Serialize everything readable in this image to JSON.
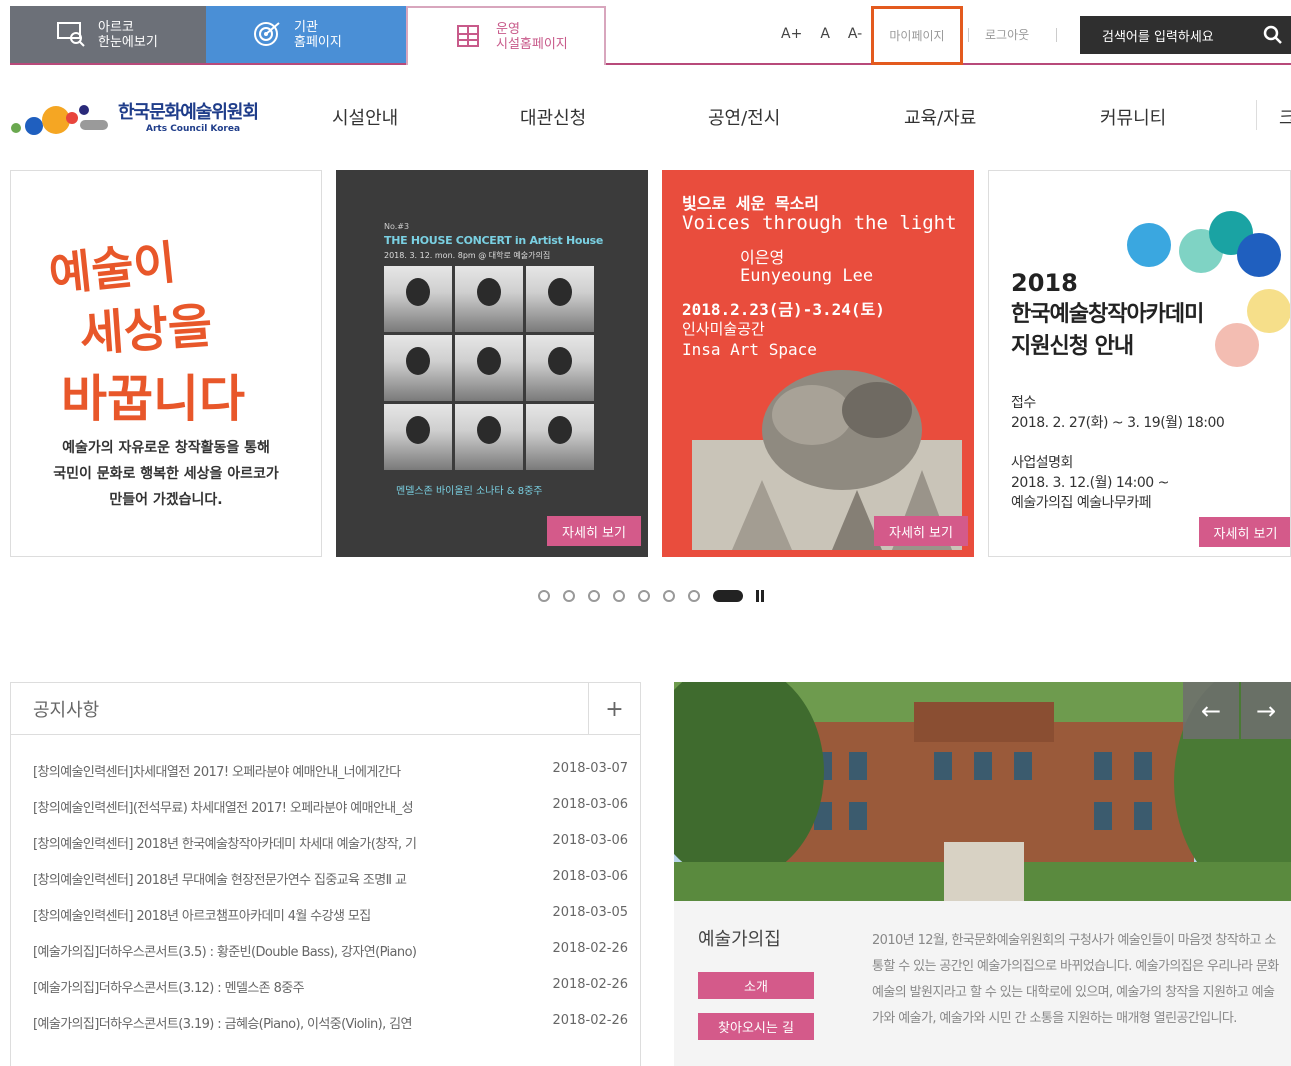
{
  "topbar": {
    "tabs": [
      {
        "label": "아르코\n한눈에보기",
        "icon": "monitor-search-icon"
      },
      {
        "label": "기관\n홈페이지",
        "icon": "target-icon"
      },
      {
        "label": "운영\n시설홈페이지",
        "icon": "building-icon"
      }
    ],
    "font_sizes": [
      "A+",
      "A",
      "A-"
    ],
    "mypage": "마이페이지",
    "logout": "로그아웃",
    "search_placeholder": "검색어를 입력하세요",
    "highlight_color": "#e35a1e"
  },
  "logo": {
    "kr": "한국문화예술위원회",
    "en": "Arts Council Korea"
  },
  "nav": {
    "items": [
      "시설안내",
      "대관신청",
      "공연/전시",
      "교육/자료",
      "커뮤니티"
    ],
    "more": "크"
  },
  "banners": {
    "b1": {
      "calligraphy": "예술이 세상을 바꿉니다",
      "desc": "예술가의 자유로운 창작활동을 통해\n국민이 문화로 행복한 세상을 아르코가\n만들어 가겠습니다."
    },
    "b2": {
      "no": "No.#3",
      "title": "THE HOUSE CONCERT in Artist House",
      "date": "2018. 3. 12. mon. 8pm @ 대학로 예술가의집",
      "caption": "멘델스존 바이올린 소나타 & 8중주",
      "more": "자세히 보기"
    },
    "b3": {
      "line1": "빛으로 세운 목소리",
      "line2": "Voices through the light",
      "line3": "이은영",
      "line4": "Eunyeoung Lee",
      "line5": "2018.2.23(금)-3.24(토)",
      "line6": "인사미술공간",
      "line7": "Insa Art Space",
      "more": "자세히 보기"
    },
    "b4": {
      "year": "2018",
      "head": "한국예술창작아카데미\n지원신청 안내",
      "info1": "접수\n2018. 2. 27(화) ~ 3. 19(월) 18:00",
      "info2": "사업설명회\n2018. 3. 12.(월) 14:00 ~\n예술가의집 예술나무카페",
      "more": "자세히 보기"
    }
  },
  "pager": {
    "dots": 8,
    "active_index": 7
  },
  "notices": {
    "title": "공지사항",
    "plus": "+",
    "items": [
      {
        "title": "[창의예술인력센터]차세대열전 2017! 오페라분야 예매안내_너에게간다",
        "date": "2018-03-07"
      },
      {
        "title": "[창의예술인력센터](전석무료) 차세대열전 2017! 오페라분야 예매안내_성",
        "date": "2018-03-06"
      },
      {
        "title": "[창의예술인력센터] 2018년 한국예술창작아카데미 차세대 예술가(창작, 기",
        "date": "2018-03-06"
      },
      {
        "title": "[창의예술인력센터] 2018년 무대예술 현장전문가연수 집중교육 조명Ⅱ 교",
        "date": "2018-03-06"
      },
      {
        "title": "[창의예술인력센터] 2018년 아르코챔프아카데미 4월 수강생 모집",
        "date": "2018-03-05"
      },
      {
        "title": "[예술가의집]더하우스콘서트(3.5) : 황준빈(Double Bass), 강자연(Piano)",
        "date": "2018-02-26"
      },
      {
        "title": "[예술가의집]더하우스콘서트(3.12) : 멘델스존 8중주",
        "date": "2018-02-26"
      },
      {
        "title": "[예술가의집]더하우스콘서트(3.19) : 금혜승(Piano), 이석중(Violin), 김연",
        "date": "2018-02-26"
      }
    ]
  },
  "house": {
    "name": "예술가의집",
    "btn_intro": "소개",
    "btn_directions": "찾아오시는 길",
    "desc": "2010년 12월, 한국문화예술위원회의 구청사가 예술인들이 마음껏 창작하고 소통할 수 있는 공간인 예술가의집으로 바뀌었습니다. 예술가의집은 우리나라 문화예술의 발원지라고 할 수 있는 대학로에 있으며, 예술가의 창작을 지원하고 예술가와 예술가, 예술가와 시민 간 소통을 지원하는 매개형 열린공간입니다.",
    "prev": "←",
    "next": "→"
  },
  "colors": {
    "accent_pink": "#d45a8a",
    "blue_tab": "#4a8fd6",
    "gray_tab": "#6c7078"
  }
}
